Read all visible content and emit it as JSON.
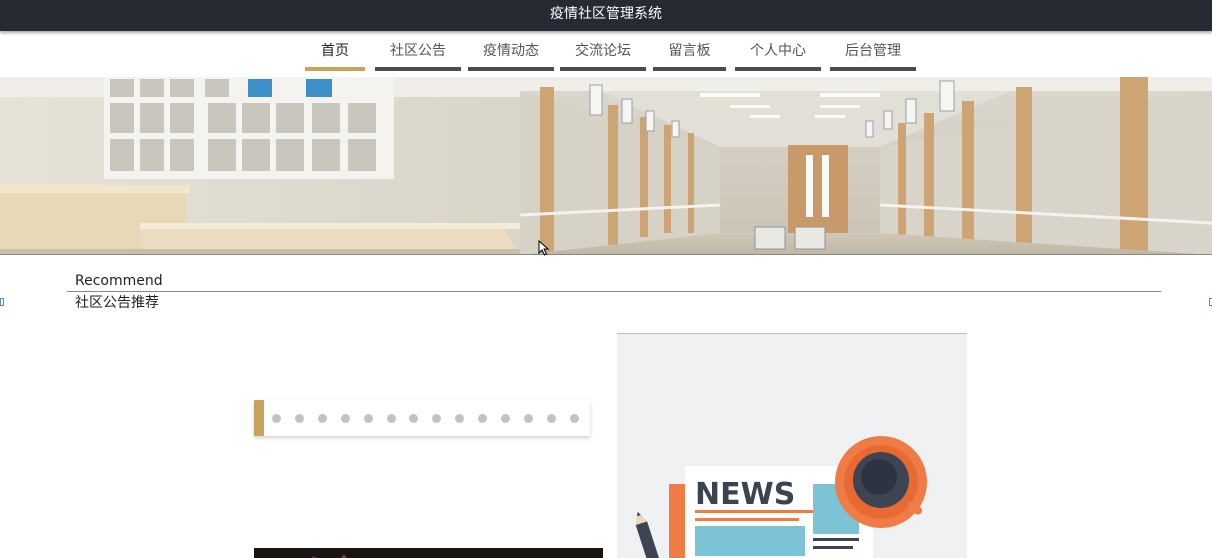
{
  "app": {
    "title": "疫情社区管理系统"
  },
  "nav": {
    "items": [
      {
        "label": "首页",
        "active": true
      },
      {
        "label": "社区公告",
        "active": false
      },
      {
        "label": "疫情动态",
        "active": false
      },
      {
        "label": "交流论坛",
        "active": false
      },
      {
        "label": "留言板",
        "active": false
      },
      {
        "label": "个人中心",
        "active": false
      },
      {
        "label": "后台管理",
        "active": false
      }
    ]
  },
  "section": {
    "title_en": "Recommend",
    "title_cn": "社区公告推荐"
  },
  "news_card": {
    "image_text": "NEWS"
  },
  "colors": {
    "accent": "#c7a25a",
    "topbar": "#262a33",
    "tab_inactive": "#4d4d4d",
    "dot": "#c2c2c2"
  },
  "carousel": {
    "slides": 14
  }
}
